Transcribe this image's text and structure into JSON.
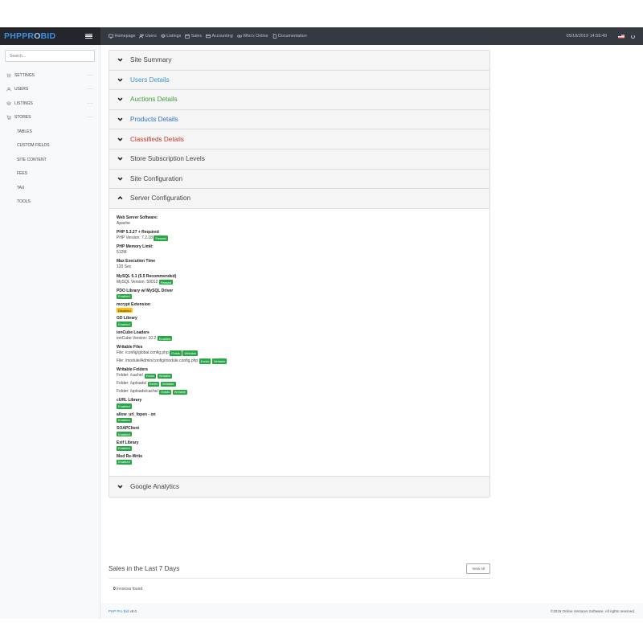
{
  "brand": {
    "logo_a": "PHPPR",
    "logo_b": "O",
    "logo_c": "BID"
  },
  "topnav": [
    {
      "label": "Homepage",
      "icon": "monitor-icon"
    },
    {
      "label": "Users",
      "icon": "users-icon"
    },
    {
      "label": "Listings",
      "icon": "layers-icon"
    },
    {
      "label": "Sales",
      "icon": "calendar-icon"
    },
    {
      "label": "Accounting",
      "icon": "credit-card-icon"
    },
    {
      "label": "Who's Online",
      "icon": "link-icon"
    },
    {
      "label": "Documentation",
      "icon": "file-icon"
    }
  ],
  "datetime": "05/18/2019 14:59:49",
  "search": {
    "placeholder": "Search..."
  },
  "sidebar": {
    "items": [
      {
        "label": "SETTINGS",
        "icon": "sliders-icon",
        "more": "···"
      },
      {
        "label": "USERS",
        "icon": "users-icon",
        "more": "···"
      },
      {
        "label": "LISTINGS",
        "icon": "layers-icon",
        "more": "···"
      },
      {
        "label": "STORES",
        "icon": "cart-icon",
        "more": "···"
      }
    ],
    "plain_items": [
      "TABLES",
      "CUSTOM FIELDS",
      "SITE CONTENT",
      "FEES",
      "TAX",
      "TOOLS"
    ]
  },
  "accordion": [
    {
      "title": "Site Summary",
      "color": "#444444"
    },
    {
      "title": "Users Details",
      "color": "#3b95c9"
    },
    {
      "title": "Auctions Details",
      "color": "#3e9e3e"
    },
    {
      "title": "Products Details",
      "color": "#2a72d4"
    },
    {
      "title": "Classifieds Details",
      "color": "#c0392b"
    },
    {
      "title": "Store Subscription Levels",
      "color": "#444444"
    },
    {
      "title": "Site Configuration",
      "color": "#444444"
    },
    {
      "title": "Server Configuration",
      "color": "#444444"
    }
  ],
  "server": {
    "web_server": {
      "label": "Web Server Software:",
      "value": "Apache"
    },
    "php": {
      "label": "PHP 5.3.27 + Required",
      "value": "PHP Version: 7.2.18",
      "badge": "Passed"
    },
    "memory": {
      "label": "PHP Memory Limit:",
      "value": "512M"
    },
    "exec": {
      "label": "Max Execution Time",
      "value": "120 Sec"
    },
    "mysql": {
      "label": "MySQL 5.1 (5.5 Recommended)",
      "value": "MySQL Version: 50012",
      "badge": "Passed"
    },
    "pdo": {
      "label": "PDO Library w/ MySQL Driver",
      "badge": "Enabled"
    },
    "mcrypt": {
      "label": "mcrypt Extension",
      "badge": "Disabled"
    },
    "gd": {
      "label": "GD Library",
      "badge": "Enabled"
    },
    "ioncube": {
      "label": "ionCube Loaders",
      "value": "ionCube Version: 10.2",
      "badge": "Enabled"
    },
    "writable_files": {
      "label": "Writable Files",
      "f1": "File: /config/global.config.php",
      "f2": "File: /module/Admin/config/module.config.php",
      "exists": "Exists",
      "writable": "Writable"
    },
    "writable_folders": {
      "label": "Writable Folders",
      "d1": "Folder: /cache/",
      "d2": "Folder: /uploads/",
      "d3": "Folder: /uploads/cache/"
    },
    "curl": {
      "label": "cURL Library",
      "badge": "Enabled"
    },
    "url_fopen": {
      "label": "allow_url_fopen - on",
      "badge": "Enabled"
    },
    "soap": {
      "label": "SOAPClient",
      "badge": "Enabled"
    },
    "exif": {
      "label": "Exif Library",
      "badge": "Enabled"
    },
    "rewrite": {
      "label": "Mod Re-Write",
      "badge": "Enabled"
    }
  },
  "google_analytics": {
    "title": "Google Analytics"
  },
  "sales": {
    "title": "Sales in the Last 7 Days",
    "view_all": "View All",
    "count": "0",
    "found_text": "invoices found."
  },
  "footer": {
    "link": "PHP Pro Bid",
    "version": "v8.0",
    "copyright": "©2019 Online Ventures Software. All rights reserved."
  },
  "colors": {
    "topbar": "#343a40",
    "brand_bg": "#23272b",
    "badge_green": "#28a745",
    "badge_yellow": "#ffc107"
  }
}
